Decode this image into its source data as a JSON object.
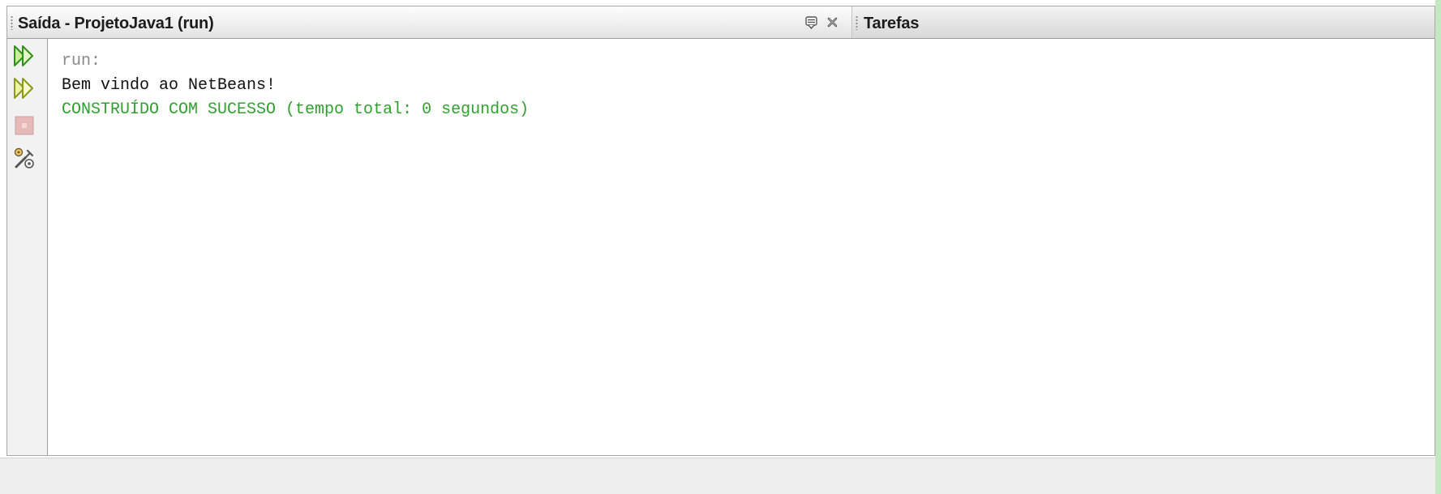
{
  "output_panel": {
    "tab_title": "Saída - ProjetoJava1 (run)",
    "tab_icons": [
      "minimize-window-icon",
      "close-icon"
    ]
  },
  "tasks_panel": {
    "tab_title": "Tarefas"
  },
  "toolbar": {
    "icons": [
      "rerun-icon",
      "rerun-with-arguments-icon",
      "stop-icon",
      "settings-icon"
    ]
  },
  "console": {
    "lines": [
      {
        "text": "run:",
        "kind": "info"
      },
      {
        "text": "Bem vindo ao NetBeans!",
        "kind": "output"
      },
      {
        "text": "CONSTRUÍDO COM SUCESSO (tempo total: 0 segundos)",
        "kind": "success"
      }
    ]
  },
  "colors": {
    "success_text": "#2fa12f",
    "info_text": "#8a8a8a",
    "output_text": "#111111",
    "accent_strip": "#c5e8c2"
  }
}
